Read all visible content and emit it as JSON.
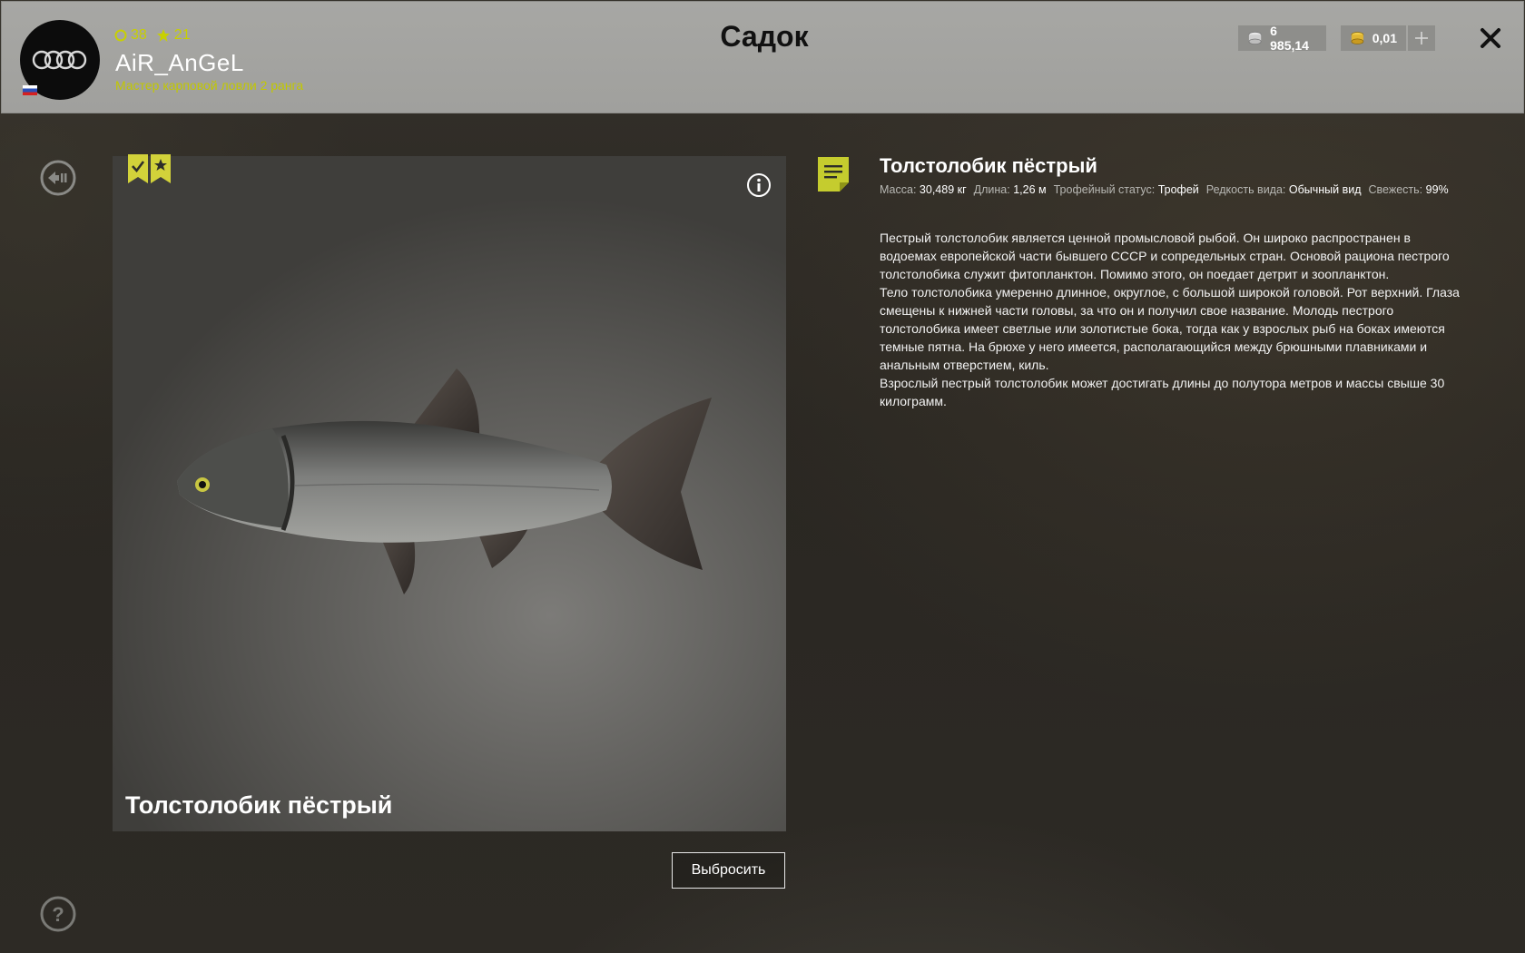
{
  "header": {
    "title": "Садок",
    "player": {
      "level": "38",
      "stars": "21",
      "name": "AiR_AnGeL",
      "rank": "Мастер карповой ловли 2 ранга"
    },
    "currency": {
      "silver": "6 985,14",
      "gold": "0,01"
    }
  },
  "fish": {
    "caption": "Толстолобик пёстрый",
    "name": "Толстолобик пёстрый",
    "properties": [
      {
        "label": "Масса:",
        "value": "30,489 кг"
      },
      {
        "label": "Длина:",
        "value": "1,26 м"
      },
      {
        "label": "Трофейный статус:",
        "value": "Трофей"
      },
      {
        "label": "Редкость вида:",
        "value": "Обычный вид"
      },
      {
        "label": "Свежесть:",
        "value": "99%"
      }
    ],
    "description": [
      "Пестрый толстолобик является ценной промысловой рыбой. Он широко распространен в водоемах европейской части бывшего СССР и сопредельных стран. Основой рациона пестрого толстолобика служит фитопланктон. Помимо этого, он поедает детрит и зоопланктон.",
      "Тело толстолобика умеренно длинное, округлое, с большой широкой головой. Рот верхний. Глаза смещены к нижней части головы, за что он и получил свое название. Молодь пестрого толстолобика имеет светлые или золотистые бока, тогда как у взрослых рыб на боках имеются темные пятна. На брюхе у него имеется, располагающийся между брюшными плавниками и анальным отверстием, киль.",
      "Взрослый пестрый толстолобик может достигать длины до полутора метров и массы свыше 30 килограмм."
    ]
  },
  "actions": {
    "discard_label": "Выбросить"
  },
  "icons": {
    "back": "back-arrow-icon",
    "help": "help-icon",
    "info": "info-icon",
    "close": "close-icon",
    "add": "plus-icon",
    "silver_coin": "silver-coins-icon",
    "gold_coin": "gold-coins-icon",
    "document": "document-icon",
    "level": "level-circle-icon",
    "star": "star-icon",
    "check_badge": "checkmark-ribbon-icon",
    "star_badge": "star-ribbon-icon"
  },
  "colors": {
    "accent_yellow": "#c8d000",
    "header_bg": "#a7a7a4",
    "badge_yellow": "#d2d23a"
  }
}
